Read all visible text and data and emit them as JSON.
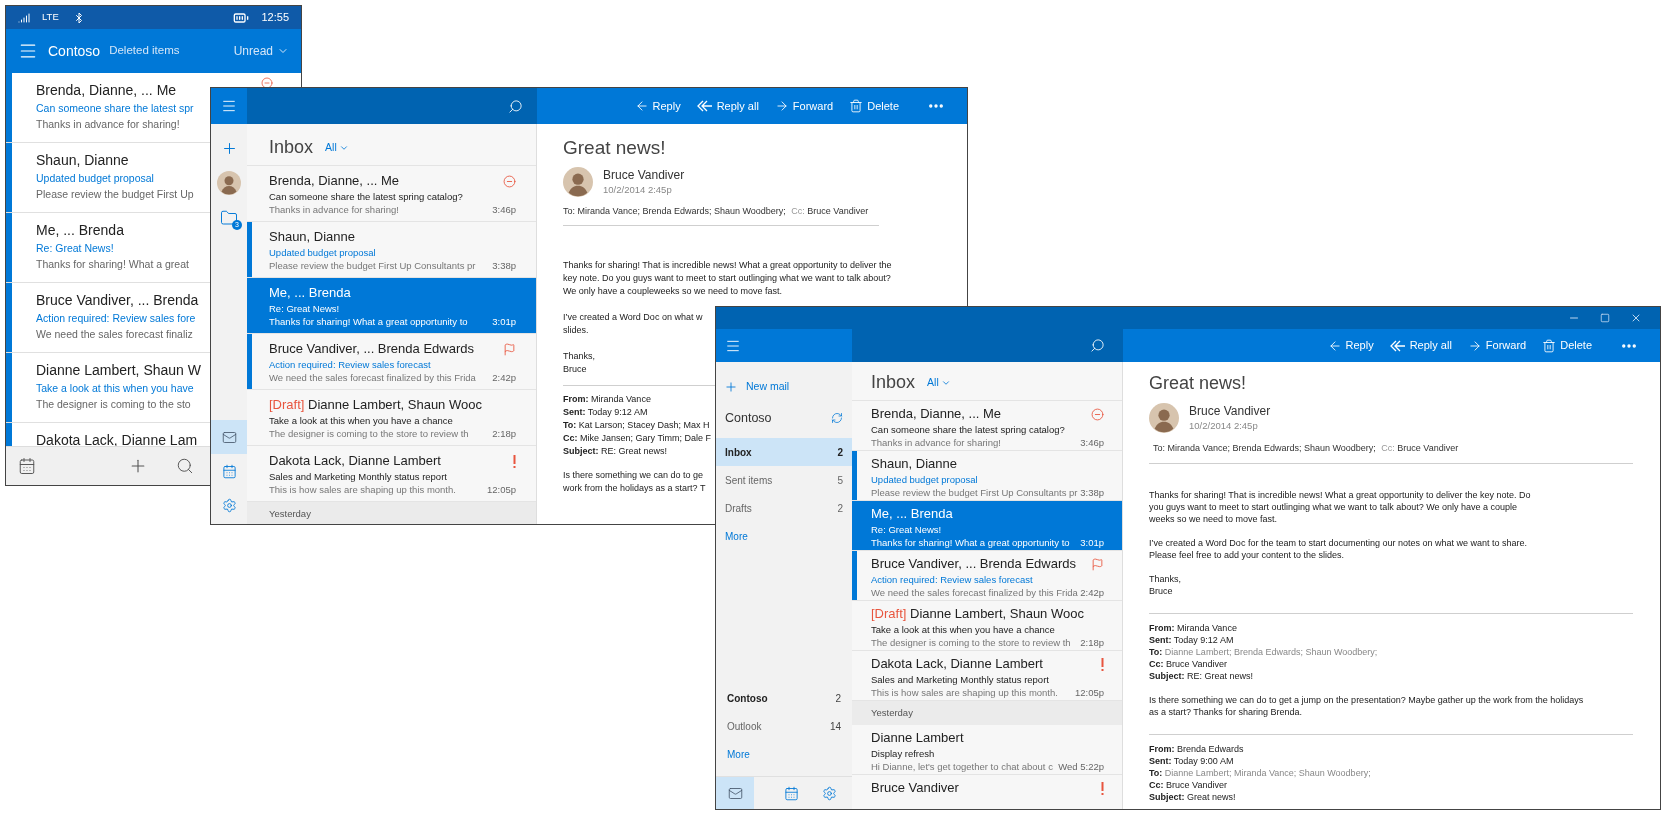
{
  "phone": {
    "status_bar": {
      "network": "LTE",
      "time": "12:55"
    },
    "header": {
      "account": "Contoso",
      "folder": "Deleted items",
      "filter": "Unread"
    },
    "messages": [
      {
        "sender": "Brenda, Dianne, ... Me",
        "subject": "Can someone share the latest spr",
        "preview": "Thanks in advance for sharing!",
        "unread": true,
        "blocked": true
      },
      {
        "sender": "Shaun, Dianne",
        "subject": "Updated budget proposal",
        "preview": "Please review the budget First Up",
        "unread": true,
        "blocked": false
      },
      {
        "sender": "Me, ... Brenda",
        "subject": "Re: Great News!",
        "preview": "Thanks for sharing! What a great",
        "unread": true,
        "blocked": false
      },
      {
        "sender": "Bruce Vandiver, ... Brenda",
        "subject": "Action required: Review sales fore",
        "preview": "We need the sales forecast finaliz",
        "unread": true,
        "blocked": false
      },
      {
        "sender": "Dianne Lambert, Shaun W",
        "subject": "Take a look at this when you have",
        "preview": "The designer is coming to the sto",
        "unread": true,
        "blocked": false
      },
      {
        "sender": "Dakota Lack, Dianne Lam",
        "unread": true,
        "blocked": false
      }
    ]
  },
  "tablet": {
    "rail": {
      "folder_badge": "3"
    },
    "nav": [
      {
        "kind": "mail",
        "selected": true
      },
      {
        "kind": "calendar",
        "selected": false
      },
      {
        "kind": "settings",
        "selected": false
      }
    ],
    "list": {
      "title": "Inbox",
      "filter": "All",
      "messages": [
        {
          "sender": "Brenda, Dianne, ... Me",
          "subject": "Can someone share the latest spring catalog?",
          "preview": "Thanks in advance for sharing!",
          "time": "3:46p",
          "unread": false,
          "selected": false,
          "blocked": true,
          "flagged": false,
          "important": false
        },
        {
          "sender": "Shaun, Dianne",
          "subject": "Updated budget proposal",
          "preview": "Please review the budget First Up Consultants pr",
          "time": "3:38p",
          "unread": true,
          "selected": false,
          "blocked": false,
          "flagged": false,
          "important": false
        },
        {
          "sender": "Me, ... Brenda",
          "subject": "Re: Great News!",
          "preview": "Thanks for sharing! What a great opportunity to",
          "time": "3:01p",
          "unread": false,
          "selected": true,
          "blocked": false,
          "flagged": false,
          "important": false
        },
        {
          "sender": "Bruce Vandiver, ... Brenda Edwards",
          "subject": "Action required: Review sales forecast",
          "preview": "We need the sales forecast finalized by this Frida",
          "time": "2:42p",
          "unread": true,
          "selected": false,
          "blocked": false,
          "flagged": true,
          "important": false
        },
        {
          "draft_label": "[Draft]",
          "sender": "Dianne Lambert, Shaun Wooc",
          "subject": "Take a look at this when you have a chance",
          "preview": "The designer is coming to the store to review th",
          "time": "2:18p",
          "unread": false,
          "selected": false,
          "blocked": false,
          "flagged": false,
          "important": false
        },
        {
          "sender": "Dakota Lack, Dianne Lambert",
          "subject": "Sales and Marketing Monthly status report",
          "preview": "This is how sales are shaping up this month.",
          "time": "12:05p",
          "unread": false,
          "selected": false,
          "blocked": false,
          "flagged": false,
          "important": true
        }
      ],
      "earlier": {
        "label": "Yesterday"
      }
    },
    "reading": {
      "toolbar": [
        {
          "kind": "reply",
          "label": "Reply"
        },
        {
          "kind": "reply_all",
          "label": "Reply all"
        },
        {
          "kind": "forward",
          "label": "Forward"
        },
        {
          "kind": "delete",
          "label": "Delete"
        },
        {
          "kind": "more"
        }
      ],
      "subject": "Great news!",
      "sender": "Bruce Vandiver",
      "date": "10/2/2014 2:45p",
      "to_label": "To:",
      "to": "Miranda Vance; Brenda Edwards; Shaun Woodbery;",
      "cc_label": "Cc:",
      "cc": "Bruce Vandiver",
      "body": [
        [
          "Thanks for sharing! That is incredible news! What a great opportunity to deliver the",
          "key note. Do you guys want to meet to start outlinging what we want to talk about?",
          "We only have a coupleweeks so we need to move fast."
        ],
        [
          "I’ve created a Word Doc on what w",
          "slides."
        ],
        [
          "Thanks,",
          "Bruce"
        ]
      ],
      "quoted": [
        {
          "fields": [
            {
              "label": "From:",
              "value": "Miranda Vance",
              "muted": false
            },
            {
              "label": "Sent:",
              "value": "Today 9:12 AM",
              "muted": false
            },
            {
              "label": "To:",
              "value": "Kat Larson; Stacey Dash; Max H",
              "muted": false
            },
            {
              "label": "Cc:",
              "value": "Mike Jansen; Gary Timm; Dale F",
              "muted": false
            },
            {
              "label": "Subject:",
              "value": "RE: Great news!",
              "muted": false
            }
          ],
          "body": [
            [
              "Is there something we can do to ge",
              "work from the holidays as a start? T"
            ]
          ]
        }
      ]
    }
  },
  "desktop": {
    "sidebar": {
      "new_mail": "New mail",
      "account": "Contoso",
      "folders": [
        {
          "name": "Inbox",
          "count": "2",
          "selected": true
        },
        {
          "name": "Sent items",
          "count": "5",
          "selected": false
        },
        {
          "name": "Drafts",
          "count": "2",
          "selected": false
        }
      ],
      "more": "More",
      "accounts": [
        {
          "name": "Contoso",
          "count": "2",
          "current": true
        },
        {
          "name": "Outlook",
          "count": "14",
          "current": false
        }
      ],
      "accounts_more": "More"
    },
    "nav": [
      {
        "kind": "mail",
        "selected": true
      },
      {
        "kind": "calendar",
        "selected": false
      },
      {
        "kind": "settings",
        "selected": false
      }
    ],
    "list": {
      "title": "Inbox",
      "filter": "All",
      "messages": [
        {
          "sender": "Brenda, Dianne, ... Me",
          "subject": "Can someone share the latest spring catalog?",
          "preview": "Thanks in advance for sharing!",
          "time": "3:46p",
          "unread": false,
          "selected": false,
          "blocked": true,
          "flagged": false,
          "important": false
        },
        {
          "sender": "Shaun, Dianne",
          "subject": "Updated budget proposal",
          "preview": "Please review the budget First Up Consultants pr",
          "time": "3:38p",
          "unread": true,
          "selected": false,
          "blocked": false,
          "flagged": false,
          "important": false
        },
        {
          "sender": "Me, ... Brenda",
          "subject": "Re: Great News!",
          "preview": "Thanks for sharing! What a great opportunity to",
          "time": "3:01p",
          "unread": false,
          "selected": true,
          "blocked": false,
          "flagged": false,
          "important": false
        },
        {
          "sender": "Bruce Vandiver, ... Brenda Edwards",
          "subject": "Action required: Review sales forecast",
          "preview": "We need the sales forecast finalized by this Frida",
          "time": "2:42p",
          "unread": true,
          "selected": false,
          "blocked": false,
          "flagged": true,
          "important": false
        },
        {
          "draft_label": "[Draft]",
          "sender": "Dianne Lambert, Shaun Wooc",
          "subject": "Take a look at this when you have a chance",
          "preview": "The designer is coming to the store to review th",
          "time": "2:18p",
          "unread": false,
          "selected": false,
          "blocked": false,
          "flagged": false,
          "important": false
        },
        {
          "sender": "Dakota Lack, Dianne Lambert",
          "subject": "Sales and Marketing Monthly status report",
          "preview": "This is how sales are shaping up this month.",
          "time": "12:05p",
          "unread": false,
          "selected": false,
          "blocked": false,
          "flagged": false,
          "important": true
        }
      ],
      "earlier": {
        "label": "Yesterday",
        "messages": [
          {
            "sender": "Dianne Lambert",
            "subject": "Display refresh",
            "preview": "Hi Dianne, let's get together to chat about c",
            "time": "Wed 5:22p",
            "unread": false,
            "selected": false,
            "blocked": false,
            "flagged": false,
            "important": false
          },
          {
            "sender": "Bruce Vandiver",
            "unread": false,
            "selected": false,
            "blocked": false,
            "flagged": false,
            "important": true
          }
        ]
      }
    },
    "reading": {
      "toolbar": [
        {
          "kind": "reply",
          "label": "Reply"
        },
        {
          "kind": "reply_all",
          "label": "Reply all"
        },
        {
          "kind": "forward",
          "label": "Forward"
        },
        {
          "kind": "delete",
          "label": "Delete"
        },
        {
          "kind": "more"
        }
      ],
      "subject": "Great news!",
      "sender": "Bruce Vandiver",
      "date": "10/2/2014 2:45p",
      "to_label": "To:",
      "to": "Miranda Vance; Brenda Edwards; Shaun Woodbery;",
      "cc_label": "Cc:",
      "cc": "Bruce Vandiver",
      "body": [
        [
          "Thanks for sharing! That is incredible news! What a great opportunity to deliver the key note. Do",
          "you guys want to meet to start outlinging what we want to talk about? We only have a couple",
          "weeks so we need to move fast."
        ],
        [
          "I’ve created a Word Doc for the team to start documenting our notes on what we want to share.",
          "Please feel free to add your content to the slides."
        ],
        [
          "Thanks,",
          "Bruce"
        ]
      ],
      "quoted": [
        {
          "fields": [
            {
              "label": "From:",
              "value": "Miranda Vance",
              "muted": false
            },
            {
              "label": "Sent:",
              "value": "Today 9:12 AM",
              "muted": false
            },
            {
              "label": "To:",
              "value": "Dianne Lambert; Brenda Edwards; Shaun Woodbery;",
              "muted": true
            },
            {
              "label": "Cc:",
              "value": "Bruce Vandiver",
              "muted": false
            },
            {
              "label": "Subject:",
              "value": "RE: Great news!",
              "muted": false
            }
          ],
          "body": [
            [
              "Is there something we can do to get a jump on the presentation? Maybe gather up the work from the holidays",
              "as a start? Thanks for sharing Brenda."
            ]
          ]
        },
        {
          "fields": [
            {
              "label": "From:",
              "value": "Brenda Edwards",
              "muted": false
            },
            {
              "label": "Sent:",
              "value": "Today 9:00 AM",
              "muted": false
            },
            {
              "label": "To:",
              "value": "Dianne Lambert; Miranda Vance; Shaun Woodbery;",
              "muted": true
            },
            {
              "label": "Cc:",
              "value": "Bruce Vandiver",
              "muted": false
            },
            {
              "label": "Subject:",
              "value": "Great news!",
              "muted": false
            }
          ]
        }
      ]
    }
  }
}
